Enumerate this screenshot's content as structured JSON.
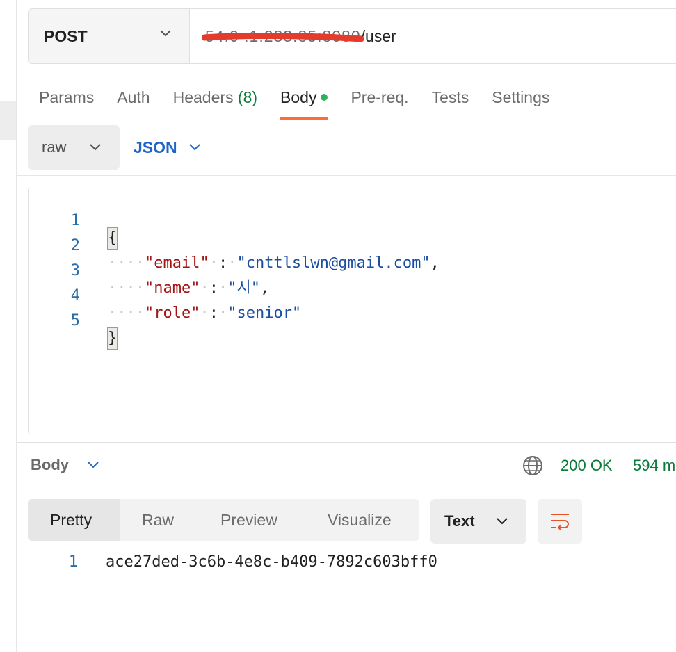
{
  "request": {
    "method": "POST",
    "url_host": "54.0 .1.233.85:8080",
    "url_path": "/user"
  },
  "tabs": [
    {
      "label": "Params"
    },
    {
      "label": "Auth"
    },
    {
      "label": "Headers",
      "count": "(8)"
    },
    {
      "label": "Body",
      "active": true
    },
    {
      "label": "Pre-req."
    },
    {
      "label": "Tests"
    },
    {
      "label": "Settings"
    }
  ],
  "body_mode": "raw",
  "body_format": "JSON",
  "editor": {
    "line_numbers": [
      "1",
      "2",
      "3",
      "4",
      "5"
    ],
    "open_brace": "{",
    "close_brace": "}",
    "lines": [
      {
        "key": "\"email\"",
        "value": "\"cnttlslwn@gmail.com\"",
        "trail": ","
      },
      {
        "key": "\"name\"",
        "value": "\"시\"",
        "trail": ","
      },
      {
        "key": "\"role\"",
        "value": "\"senior\"",
        "trail": ""
      }
    ]
  },
  "response": {
    "section_label": "Body",
    "status": "200 OK",
    "time": "594 m",
    "view_tabs": [
      "Pretty",
      "Raw",
      "Preview",
      "Visualize"
    ],
    "format": "Text",
    "line_number": "1",
    "content": "ace27ded-3c6b-4e8c-b409-7892c603bff0"
  },
  "colors": {
    "accent": "#ff6c37",
    "status_green": "#0b7a3b",
    "link_blue": "#1f64c8",
    "redaction": "#e53b2c"
  },
  "icons": [
    "chevron-down-icon",
    "globe-icon",
    "wrap-lines-icon"
  ]
}
